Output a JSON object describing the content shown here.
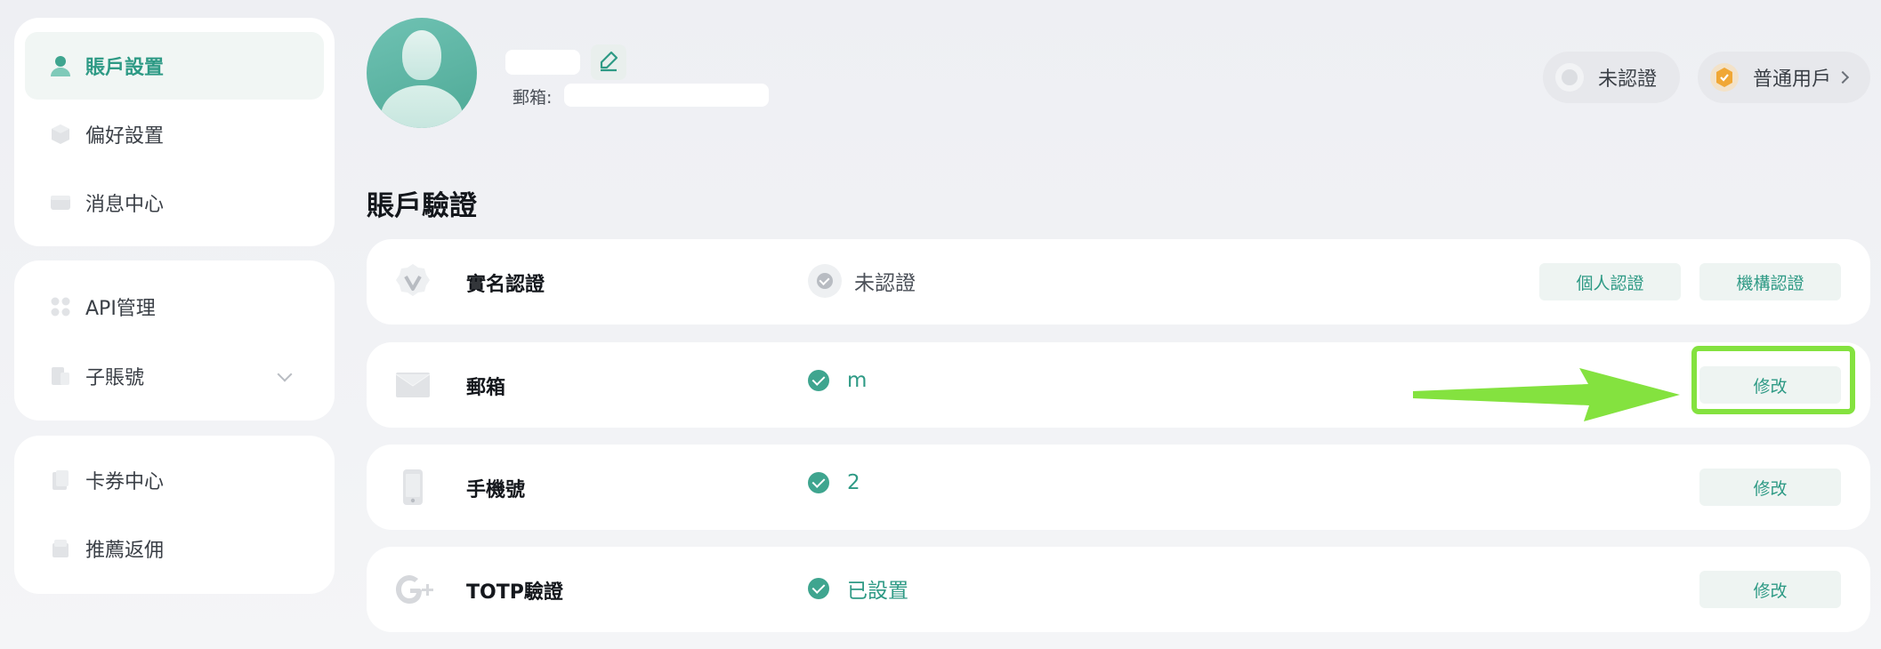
{
  "sidebar": {
    "group1": [
      {
        "label": "賬戶設置",
        "icon": "user-icon",
        "active": true
      },
      {
        "label": "偏好設置",
        "icon": "cube-icon"
      },
      {
        "label": "消息中心",
        "icon": "message-icon"
      }
    ],
    "group2": [
      {
        "label": "API管理",
        "icon": "api-icon"
      },
      {
        "label": "子賬號",
        "icon": "sub-account-icon"
      }
    ],
    "group3": [
      {
        "label": "卡券中心",
        "icon": "coupon-icon"
      },
      {
        "label": "推薦返佣",
        "icon": "referral-icon"
      }
    ]
  },
  "profile": {
    "email_label": "郵箱:",
    "verify_badge": "未認證",
    "user_level": "普通用戶"
  },
  "section_title": "賬戶驗證",
  "rows": [
    {
      "label": "實名認證",
      "status": "未認證",
      "buttons": [
        "個人認證",
        "機構認證"
      ]
    },
    {
      "label": "郵箱",
      "status": "m",
      "button": "修改"
    },
    {
      "label": "手機號",
      "status": "2",
      "button": "修改"
    },
    {
      "label": "TOTP驗證",
      "status": "已設置",
      "button": "修改"
    }
  ],
  "colors": {
    "accent": "#2e9a85",
    "highlight": "#84e23f"
  }
}
